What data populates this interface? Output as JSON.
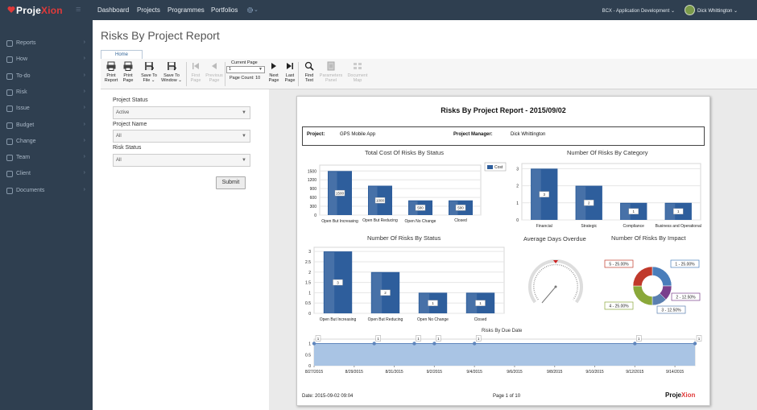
{
  "app": {
    "logo_main": "Proje",
    "logo_accent": "Xion",
    "menu_toggle": "≡"
  },
  "topnav": {
    "items": [
      "Dashboard",
      "Projects",
      "Programmes",
      "Portfolios"
    ],
    "gear": "gear-icon"
  },
  "app_selector": "BCX - Application Development ⌄",
  "user": {
    "name": "Dick Whittington ⌄"
  },
  "sidebar": {
    "items": [
      {
        "label": "Reports",
        "icon": "grid-icon"
      },
      {
        "label": "How",
        "icon": "info-icon"
      },
      {
        "label": "To-do",
        "icon": "check-icon"
      },
      {
        "label": "Risk",
        "icon": "warning-icon"
      },
      {
        "label": "Issue",
        "icon": "flag-icon"
      },
      {
        "label": "Budget",
        "icon": "money-icon"
      },
      {
        "label": "Change",
        "icon": "change-icon"
      },
      {
        "label": "Team",
        "icon": "team-icon"
      },
      {
        "label": "Client",
        "icon": "client-icon"
      },
      {
        "label": "Documents",
        "icon": "document-icon"
      }
    ]
  },
  "page": {
    "title": "Risks By Project Report"
  },
  "ribbon": {
    "tab": "Home",
    "print_report": [
      "Print",
      "Report"
    ],
    "print_page": [
      "Print",
      "Page"
    ],
    "save_file": [
      "Save To",
      "File ⌄"
    ],
    "save_window": [
      "Save To",
      "Window ⌄"
    ],
    "first_page": [
      "First",
      "Page"
    ],
    "previous_page": [
      "Previous",
      "Page"
    ],
    "current_page_label": "Current Page",
    "current_page_value": "1",
    "page_count": "Page Count: 10",
    "next_page": [
      "Next",
      "Page"
    ],
    "last_page": [
      "Last",
      "Page"
    ],
    "find_text": [
      "Find",
      "Text"
    ],
    "parameters_panel": [
      "Parameters",
      "Panel"
    ],
    "document_map": [
      "Document",
      "Map"
    ]
  },
  "filters": {
    "project_status": {
      "label": "Project Status",
      "value": "Active"
    },
    "project_name": {
      "label": "Project Name",
      "value": "All"
    },
    "risk_status": {
      "label": "Risk Status",
      "value": "All"
    },
    "submit": "Submit"
  },
  "report": {
    "title": "Risks By Project Report - 2015/09/02",
    "project_label": "Project:",
    "project_value": "GPS Mobile App",
    "manager_label": "Project Manager:",
    "manager_value": "Dick Whittington",
    "footer_date": "Date: 2015-09-02 09:04",
    "footer_page": "Page 1 of 10",
    "footer_logo_main": "Proje",
    "footer_logo_accent": "Xion"
  },
  "chart_data": [
    {
      "type": "bar",
      "title": "Total Cost Of Risks By Status",
      "categories": [
        "Open But Increasing",
        "Open But Reducing",
        "Open No Change",
        "Closed"
      ],
      "series": [
        {
          "name": "Cost",
          "values": [
            1500,
            1000,
            500,
            500
          ]
        }
      ],
      "yticks": [
        0,
        300,
        600,
        900,
        1200,
        1500
      ],
      "ylim": [
        0,
        1700
      ],
      "legend": "right",
      "color": "#2e5e9c"
    },
    {
      "type": "bar",
      "title": "Number Of Risks By Category",
      "categories": [
        "Financial",
        "Strategic",
        "Compliance",
        "Business and Operational"
      ],
      "values": [
        3,
        2,
        1,
        1
      ],
      "yticks": [
        0,
        1,
        2,
        3
      ],
      "ylim": [
        0,
        3.3
      ],
      "color": "#2e5e9c"
    },
    {
      "type": "bar",
      "title": "Number Of Risks By Status",
      "categories": [
        "Open But Increasing",
        "Open But Reducing",
        "Open No Change",
        "Closed"
      ],
      "values": [
        3,
        2,
        1,
        1
      ],
      "yticks": [
        0,
        0.5,
        1,
        1.5,
        2,
        2.5,
        3
      ],
      "ylim": [
        0,
        3.2
      ],
      "color": "#2e5e9c"
    },
    {
      "type": "gauge",
      "title": "Average Days Overdue"
    },
    {
      "type": "pie",
      "title": "Number Of Risks By Impact",
      "slices": [
        {
          "label": "1 - 25.00%",
          "value": 25,
          "color": "#4a7ebb"
        },
        {
          "label": "2 - 12.50%",
          "value": 12.5,
          "color": "#7a3f8c"
        },
        {
          "label": "3 - 12.50%",
          "value": 12.5,
          "color": "#5a7fb0"
        },
        {
          "label": "4 - 25.00%",
          "value": 25,
          "color": "#8aa83a"
        },
        {
          "label": "5 - 25.00%",
          "value": 25,
          "color": "#c0392b"
        }
      ]
    },
    {
      "type": "area",
      "title": "Risks By Due Date",
      "x": [
        "8/27/2015",
        "8/29/2015",
        "8/31/2015",
        "9/2/2015",
        "9/4/2015",
        "9/6/2015",
        "9/8/2015",
        "9/10/2015",
        "9/12/2015",
        "9/14/2015"
      ],
      "points": [
        {
          "x": "8/27/2015",
          "y": 1
        },
        {
          "x": "8/30/2015",
          "y": 1
        },
        {
          "x": "9/1/2015",
          "y": 1
        },
        {
          "x": "9/2/2015",
          "y": 1
        },
        {
          "x": "9/4/2015",
          "y": 1
        },
        {
          "x": "9/12/2015",
          "y": 1
        },
        {
          "x": "9/15/2015",
          "y": 1
        }
      ],
      "point_labels": [
        "1",
        "1",
        "1",
        "1",
        "1",
        "1",
        "1"
      ],
      "yticks": [
        0,
        0.5,
        1
      ],
      "ylim": [
        0,
        1.2
      ],
      "color": "#2e5e9c"
    }
  ]
}
